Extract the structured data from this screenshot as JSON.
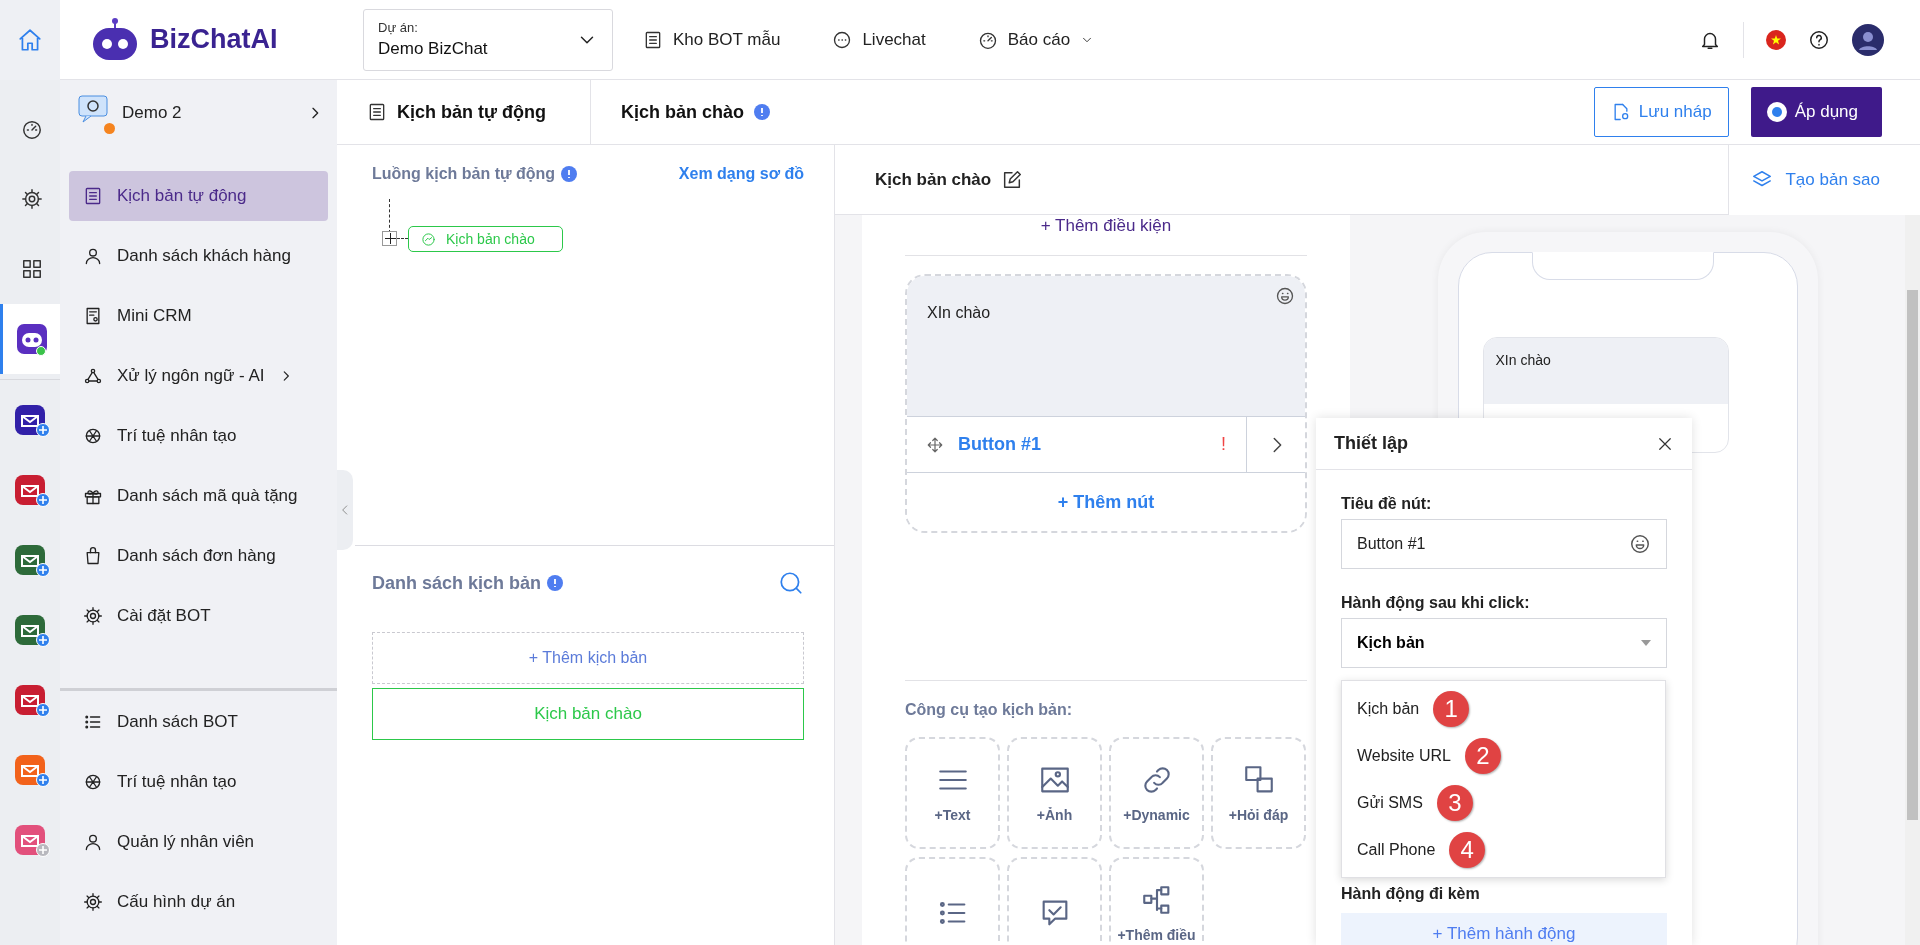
{
  "topbar": {
    "brand": "BizChatAI",
    "project_label": "Dự án:",
    "project_value": "Demo BizChat",
    "nav": [
      {
        "label": "Kho BOT mẫu",
        "dropdown": false
      },
      {
        "label": "Livechat",
        "dropdown": false
      },
      {
        "label": "Báo cáo",
        "dropdown": true
      }
    ]
  },
  "rail": {
    "items": [
      {
        "selected": false
      },
      {
        "selected": false
      },
      {
        "selected": false
      },
      {
        "selected": true
      }
    ],
    "apps": [
      {
        "enabled": true
      },
      {
        "enabled": true
      },
      {
        "enabled": true
      },
      {
        "enabled": true
      },
      {
        "enabled": true
      },
      {
        "enabled": true
      },
      {
        "enabled": false
      }
    ]
  },
  "sidebar": {
    "bot_name": "Demo 2",
    "items": [
      {
        "label": "Kịch bản tự động",
        "selected": true,
        "submenu": false
      },
      {
        "label": "Danh sách khách hàng",
        "selected": false,
        "submenu": false
      },
      {
        "label": "Mini CRM",
        "selected": false,
        "submenu": false
      },
      {
        "label": "Xử lý ngôn ngữ - AI",
        "selected": false,
        "submenu": true
      },
      {
        "label": "Trí tuệ nhân tạo",
        "selected": false,
        "submenu": false
      },
      {
        "label": "Danh sách mã quà tặng",
        "selected": false,
        "submenu": false
      },
      {
        "label": "Danh sách đơn hàng",
        "selected": false,
        "submenu": false
      },
      {
        "label": "Cài đặt BOT",
        "selected": false,
        "submenu": false
      }
    ],
    "bottom_items": [
      {
        "label": "Danh sách BOT"
      },
      {
        "label": "Trí tuệ nhân tạo"
      },
      {
        "label": "Quản lý nhân viên"
      },
      {
        "label": "Cấu hình dự án"
      }
    ]
  },
  "breadcrumb": {
    "items": [
      "Kịch bản tự động",
      "Kịch bản chào"
    ],
    "save": "Lưu nháp",
    "apply": "Áp dụng"
  },
  "flow": {
    "title": "Luồng kịch bản tự động",
    "view_link": "Xem dạng sơ đồ",
    "nodes": [
      {
        "label": "Kịch bản chào"
      }
    ],
    "list_title": "Danh sách kịch bản",
    "add_script": "+ Thêm kịch bản",
    "scripts": [
      {
        "label": "Kịch bản chào",
        "selected": true
      }
    ]
  },
  "editor": {
    "title": "Kịch bản chào",
    "copy": "Tạo bản sao",
    "add_condition": "+ Thêm điều kiện",
    "message": "XIn chào",
    "button_label": "Button #1",
    "button_warning": "!",
    "add_button": "+ Thêm nút",
    "tools_title": "Công cụ tạo kịch bản:",
    "tools": [
      {
        "kind": "text",
        "label": "+Text"
      },
      {
        "kind": "image",
        "label": "+Ảnh"
      },
      {
        "kind": "dynamic",
        "label": "+Dynamic"
      },
      {
        "kind": "qa",
        "label": "+Hỏi đáp"
      },
      {
        "kind": "list"
      },
      {
        "kind": "check"
      },
      {
        "kind": "condition",
        "label": "+Thêm điều"
      }
    ],
    "preview_message": "XIn chào"
  },
  "settings": {
    "title": "Thiết lập",
    "title_label": "Tiêu đề nút:",
    "title_value": "Button #1",
    "action_label": "Hành động sau khi click:",
    "action_value": "Kịch bản",
    "options": [
      {
        "label": "Kịch bản",
        "badge": "1"
      },
      {
        "label": "Website URL",
        "badge": "2"
      },
      {
        "label": "Gửi SMS",
        "badge": "3"
      },
      {
        "label": "Call Phone",
        "badge": "4"
      }
    ],
    "extra_label": "Hành động đi kèm",
    "add_action": "+ Thêm hành động"
  }
}
